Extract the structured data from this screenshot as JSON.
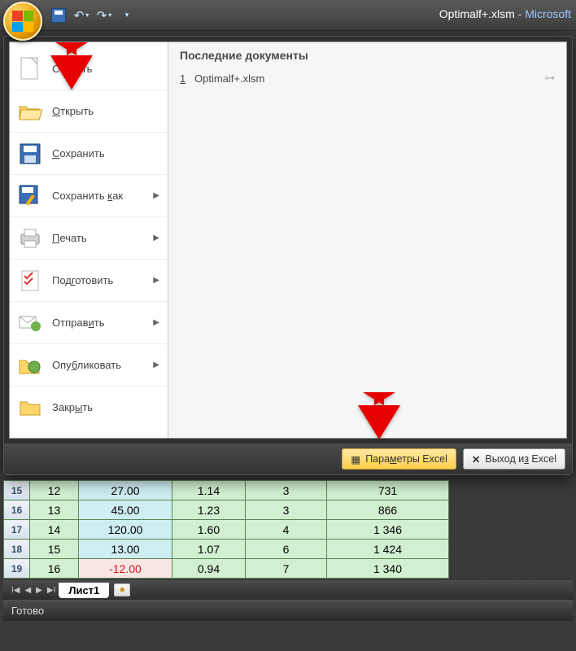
{
  "title": {
    "filename": "Optimalf+.xlsm",
    "separator": " - ",
    "app": "Microsoft"
  },
  "qat": {
    "save": "save",
    "undo": "undo",
    "redo": "redo",
    "customize": "customize"
  },
  "office_menu": {
    "items": [
      {
        "label": "Создать",
        "submenu": false
      },
      {
        "label": "Открыть",
        "submenu": false
      },
      {
        "label": "Сохранить",
        "submenu": false
      },
      {
        "label": "Сохранить как",
        "submenu": true
      },
      {
        "label": "Печать",
        "submenu": true
      },
      {
        "label": "Подготовить",
        "submenu": true
      },
      {
        "label": "Отправить",
        "submenu": true
      },
      {
        "label": "Опубликовать",
        "submenu": true
      },
      {
        "label": "Закрыть",
        "submenu": false
      }
    ],
    "recent_title": "Последние документы",
    "recent": [
      {
        "n": "1",
        "name": "Optimalf+.xlsm"
      }
    ],
    "footer": {
      "options": "Параметры Excel",
      "exit": "Выход из Excel"
    }
  },
  "sheet": {
    "rows": [
      {
        "hdr": "15",
        "a": "12",
        "b": "27.00",
        "c": "1.14",
        "d": "3",
        "e": "731",
        "neg": false
      },
      {
        "hdr": "16",
        "a": "13",
        "b": "45.00",
        "c": "1.23",
        "d": "3",
        "e": "866",
        "neg": false
      },
      {
        "hdr": "17",
        "a": "14",
        "b": "120.00",
        "c": "1.60",
        "d": "4",
        "e": "1 346",
        "neg": false
      },
      {
        "hdr": "18",
        "a": "15",
        "b": "13.00",
        "c": "1.07",
        "d": "6",
        "e": "1 424",
        "neg": false
      },
      {
        "hdr": "19",
        "a": "16",
        "b": "-12.00",
        "c": "0.94",
        "d": "7",
        "e": "1 340",
        "neg": true
      }
    ],
    "tab": "Лист1"
  },
  "status": "Готово"
}
